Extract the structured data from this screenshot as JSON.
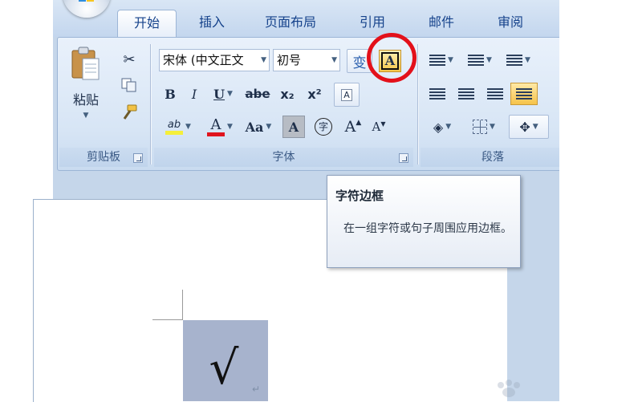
{
  "tabs": [
    {
      "label": "开始",
      "active": true
    },
    {
      "label": "插入"
    },
    {
      "label": "页面布局"
    },
    {
      "label": "引用"
    },
    {
      "label": "邮件"
    },
    {
      "label": "审阅"
    }
  ],
  "clipboard": {
    "paste_label": "粘贴",
    "group_label": "剪贴板"
  },
  "font": {
    "font_name": "宋体 (中文正文",
    "font_size": "初号",
    "phonetic_label": "变",
    "border_char_label": "A",
    "bold_label": "B",
    "italic_label": "I",
    "underline_label": "U",
    "strike_label": "abe",
    "subscript_label": "x₂",
    "superscript_label": "x²",
    "clear_label": "A",
    "case_label": "Aa",
    "shading_label": "A",
    "enclose_label": "字",
    "grow_label": "A",
    "shrink_label": "A",
    "highlight_label": "ab",
    "group_label": "字体"
  },
  "paragraph": {
    "group_label": "段落"
  },
  "tooltip": {
    "title": "字符边框",
    "description": "在一组字符或句子周围应用边框。"
  },
  "document": {
    "content": "√",
    "para_mark": "↵"
  },
  "colors": {
    "highlight_ring": "#e3101a",
    "font_color": "#e0141e",
    "highlight_color": "#f5ef3a",
    "selection": "#a7b3cd"
  }
}
